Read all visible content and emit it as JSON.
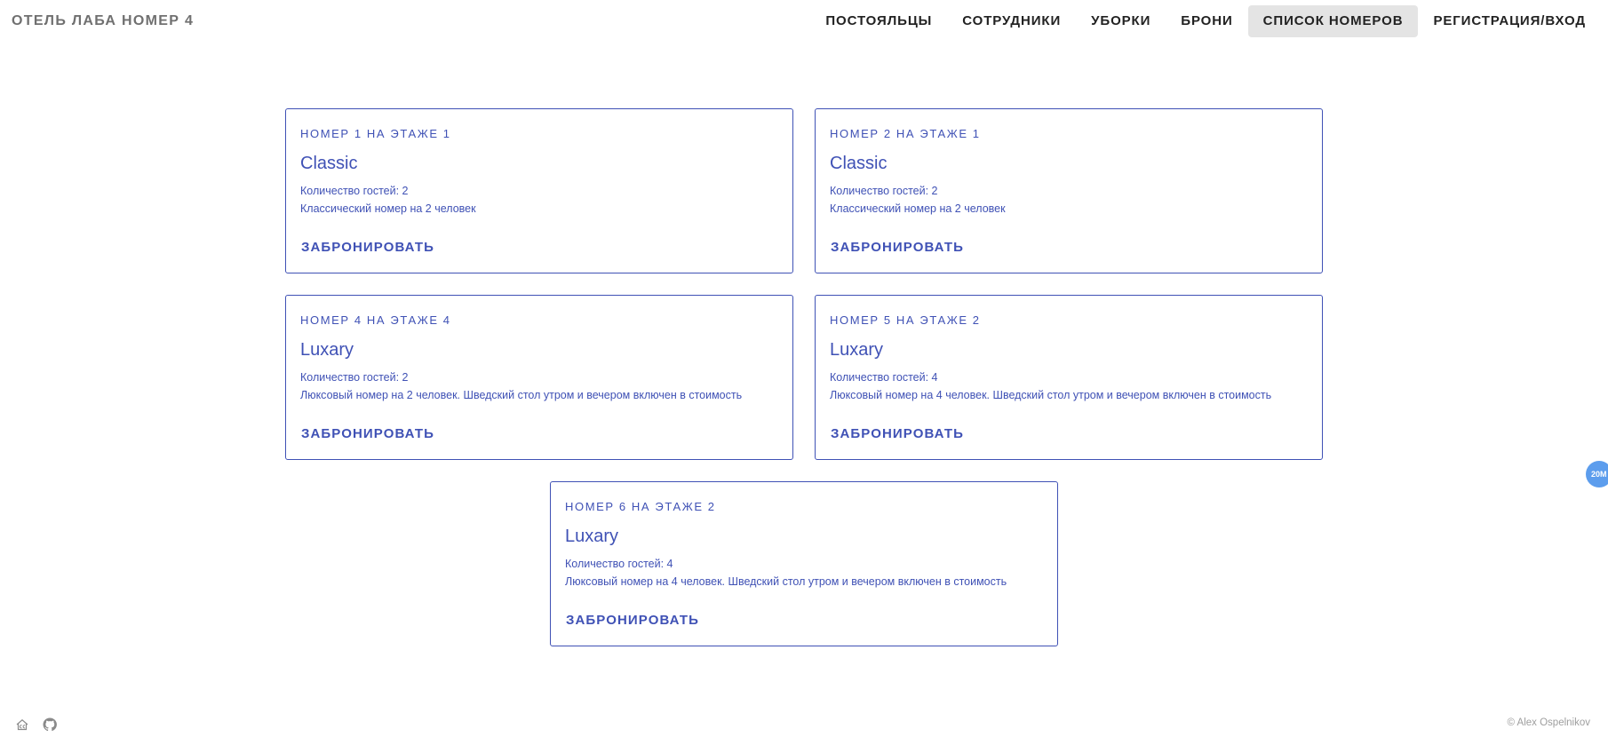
{
  "header": {
    "brand": "ОТЕЛЬ ЛАБА НОМЕР 4",
    "nav": [
      {
        "label": "ПОСТОЯЛЬЦЫ",
        "active": false
      },
      {
        "label": "СОТРУДНИКИ",
        "active": false
      },
      {
        "label": "УБОРКИ",
        "active": false
      },
      {
        "label": "БРОНИ",
        "active": false
      },
      {
        "label": "СПИСОК НОМЕРОВ",
        "active": true
      },
      {
        "label": "РЕГИСТРАЦИЯ/ВХОД",
        "active": false
      }
    ]
  },
  "rooms": [
    {
      "overline": "НОМЕР 1 НА ЭТАЖЕ 1",
      "title": "Classic",
      "guests": "Количество гостей: 2",
      "description": "Классический номер на 2 человек",
      "action": "ЗАБРОНИРОВАТЬ"
    },
    {
      "overline": "НОМЕР 2 НА ЭТАЖЕ 1",
      "title": "Classic",
      "guests": "Количество гостей: 2",
      "description": "Классический номер на 2 человек",
      "action": "ЗАБРОНИРОВАТЬ"
    },
    {
      "overline": "НОМЕР 4 НА ЭТАЖЕ 4",
      "title": "Luxary",
      "guests": "Количество гостей: 2",
      "description": "Люксовый номер на 2 человек. Шведский стол утром и вечером включен в стоимость",
      "action": "ЗАБРОНИРОВАТЬ"
    },
    {
      "overline": "НОМЕР 5 НА ЭТАЖЕ 2",
      "title": "Luxary",
      "guests": "Количество гостей: 4",
      "description": "Люксовый номер на 4 человек. Шведский стол утром и вечером включен в стоимость",
      "action": "ЗАБРОНИРОВАТЬ"
    },
    {
      "overline": "НОМЕР 6 НА ЭТАЖЕ 2",
      "title": "Luxary",
      "guests": "Количество гостей: 4",
      "description": "Люксовый номер на 4 человек. Шведский стол утром и вечером включен в стоимость",
      "action": "ЗАБРОНИРОВАТЬ"
    }
  ],
  "zoom_badge": "20M",
  "footer": {
    "icons": [
      "home-icon",
      "github-icon"
    ],
    "copyright": "© Alex Ospelnikov"
  },
  "colors": {
    "accent": "#3f51b5",
    "active_nav_bg": "#e4e4e4",
    "brand_text": "#707070",
    "badge": "#5c9ded"
  }
}
